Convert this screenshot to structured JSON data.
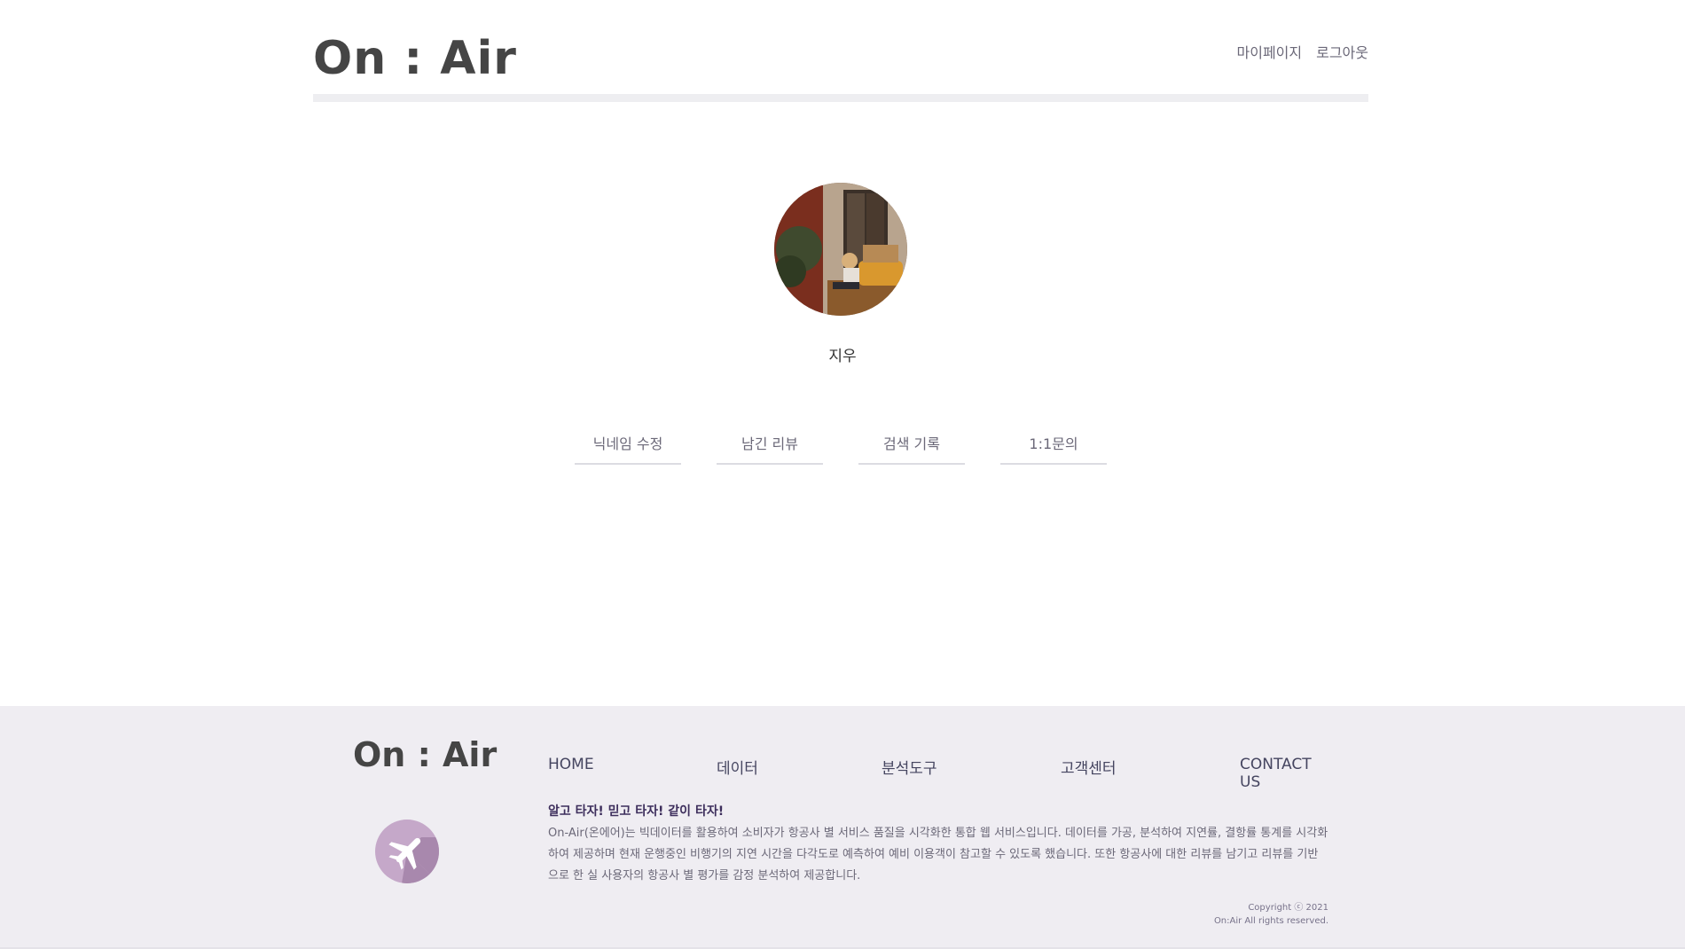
{
  "header": {
    "logo": "On : Air",
    "nav": {
      "mypage": "마이페이지",
      "logout": "로그아웃"
    }
  },
  "profile": {
    "nickname": "지우"
  },
  "tabs": [
    "닉네임 수정",
    "남긴 리뷰",
    "검색 기록",
    "1:1문의"
  ],
  "footer": {
    "logo": "On : Air",
    "icon": "airplane-icon",
    "nav": [
      "HOME",
      "데이터",
      "분석도구",
      "고객센터",
      "CONTACT US"
    ],
    "slogan": "알고 타자! 믿고 타자! 같이 타자!",
    "description": "On-Air(온에어)는 빅데이터를 활용하여 소비자가 항공사 별 서비스 품질을 시각화한 통합 웹 서비스입니다. 데이터를 가공, 분석하여 지연률, 결항률 통계를 시각화하여 제공하며 현재 운행중인 비행기의 지연 시간을 다각도로 예측하여 예비 이용객이 참고할 수 있도록 했습니다. 또한 항공사에 대한 리뷰를 남기고 리뷰를 기반으로 한 실 사용자의 항공사 별 평가를 감정 분석하여 제공합니다.",
    "copyright": "Copyright ⓒ 2021",
    "rights": "On:Air All rights reserved."
  }
}
